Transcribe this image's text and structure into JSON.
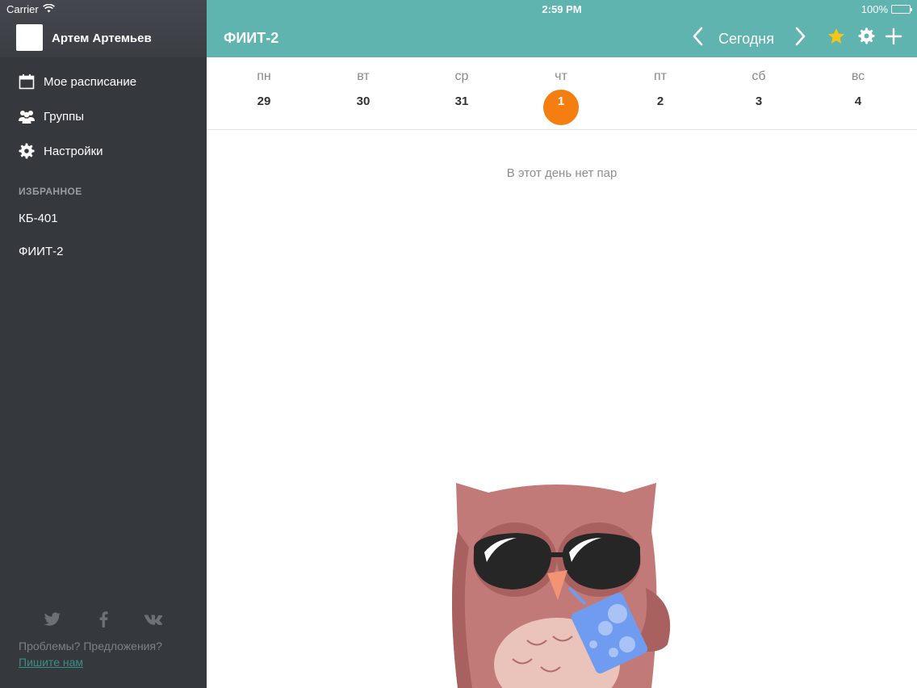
{
  "status": {
    "carrier": "Carrier",
    "time": "2:59 PM",
    "battery": "100%"
  },
  "sidebar": {
    "user_name": "Артем Артемьев",
    "nav": [
      {
        "label": "Мое расписание",
        "icon": "calendar-icon"
      },
      {
        "label": "Группы",
        "icon": "users-icon"
      },
      {
        "label": "Настройки",
        "icon": "gear-icon"
      }
    ],
    "favorites_title": "ИЗБРАННОЕ",
    "favorites": [
      "КБ-401",
      "ФИИТ-2"
    ],
    "social": [
      "twitter-icon",
      "facebook-icon",
      "vk-icon"
    ],
    "feedback_text": "Проблемы? Предложения?",
    "feedback_link": "Пишите нам"
  },
  "header": {
    "title": "ФИИТ-2",
    "today_label": "Сегодня",
    "icons": [
      "chevron-left-icon",
      "chevron-right-icon",
      "star-icon",
      "gear-icon",
      "plus-icon"
    ],
    "accent_color": "#5fb4b0",
    "star_color": "#f5c518"
  },
  "week": {
    "days": [
      {
        "name": "пн",
        "num": "29"
      },
      {
        "name": "вт",
        "num": "30"
      },
      {
        "name": "ср",
        "num": "31"
      },
      {
        "name": "чт",
        "num": "1",
        "active": true
      },
      {
        "name": "пт",
        "num": "2"
      },
      {
        "name": "сб",
        "num": "3"
      },
      {
        "name": "вс",
        "num": "4"
      }
    ],
    "active_color": "#f57e11"
  },
  "main": {
    "empty_message": "В этот день нет пар"
  }
}
